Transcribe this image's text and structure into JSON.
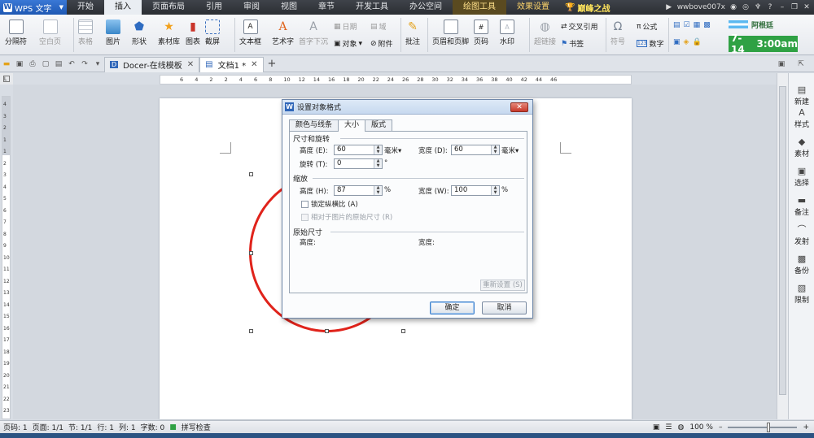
{
  "menubar": {
    "app_name": "WPS 文字",
    "items": [
      "开始",
      "插入",
      "页面布局",
      "引用",
      "审阅",
      "视图",
      "章节",
      "开发工具",
      "办公空间"
    ],
    "context_tabs": [
      "绘图工具",
      "效果设置"
    ],
    "promo": "巅峰之战",
    "user": "wwbove007x"
  },
  "ribbon": {
    "page_break": "分隔符",
    "blank_page": "空白页",
    "table": "表格",
    "picture": "图片",
    "shape": "形状",
    "material_lib": "素材库",
    "chart": "图表",
    "screenshot": "截屏",
    "textbox": "文本框",
    "wordart": "艺术字",
    "dropcap": "首字下沉",
    "date": "日期",
    "field": "域",
    "object": "对象",
    "attachment": "附件",
    "comment": "批注",
    "header_footer": "页眉和页脚",
    "page_number": "页码",
    "watermark": "水印",
    "hyperlink": "超链接",
    "cross_ref": "交叉引用",
    "bookmark": "书签",
    "symbol": "符号",
    "formula": "公式",
    "number": "数字"
  },
  "date_widget": {
    "name": "阿根廷",
    "date": "7-14",
    "time": "3:00am"
  },
  "tabs": [
    {
      "label": "Docer-在线模板"
    },
    {
      "label": "文档1 *"
    }
  ],
  "hruler_ticks": [
    "6",
    "4",
    "2",
    "2",
    "4",
    "6",
    "8",
    "10",
    "12",
    "14",
    "16",
    "18",
    "20",
    "22",
    "24",
    "26",
    "28",
    "30",
    "32",
    "34",
    "36",
    "38",
    "40",
    "42",
    "44",
    "46"
  ],
  "vruler_ticks": [
    "4",
    "3",
    "2",
    "1",
    "1",
    "2",
    "3",
    "4",
    "5",
    "6",
    "7",
    "8",
    "9",
    "10",
    "11",
    "12",
    "13",
    "14",
    "15",
    "16",
    "17",
    "18",
    "19",
    "20",
    "21",
    "22",
    "23"
  ],
  "sidebar": [
    "新建",
    "样式",
    "素材",
    "选择",
    "备注",
    "发射",
    "备份",
    "限制"
  ],
  "dialog": {
    "title": "设置对象格式",
    "tabs": [
      "颜色与线条",
      "大小",
      "版式"
    ],
    "section_size": "尺寸和旋转",
    "height_label": "高度 (E):",
    "height_value": "60",
    "height_unit": "毫米▾",
    "width_label": "宽度 (D):",
    "width_value": "60",
    "width_unit": "毫米▾",
    "rotate_label": "旋转 (T):",
    "rotate_value": "0",
    "rotate_unit": "°",
    "section_scale": "缩放",
    "scale_h_label": "高度 (H):",
    "scale_h_value": "87",
    "scale_w_label": "宽度 (W):",
    "scale_w_value": "100",
    "percent": "%",
    "lock_ratio": "锁定纵横比 (A)",
    "relative_orig": "相对于图片的原始尺寸 (R)",
    "section_orig": "原始尺寸",
    "orig_height": "高度:",
    "orig_width": "宽度:",
    "reset": "重新设置 (S)",
    "ok": "确定",
    "cancel": "取消"
  },
  "status": {
    "page": "页码: 1",
    "pages": "页面: 1/1",
    "section": "节: 1/1",
    "row": "行: 1",
    "col": "列: 1",
    "words": "字数: 0",
    "spell": "拼写检查",
    "zoom": "100 %"
  }
}
